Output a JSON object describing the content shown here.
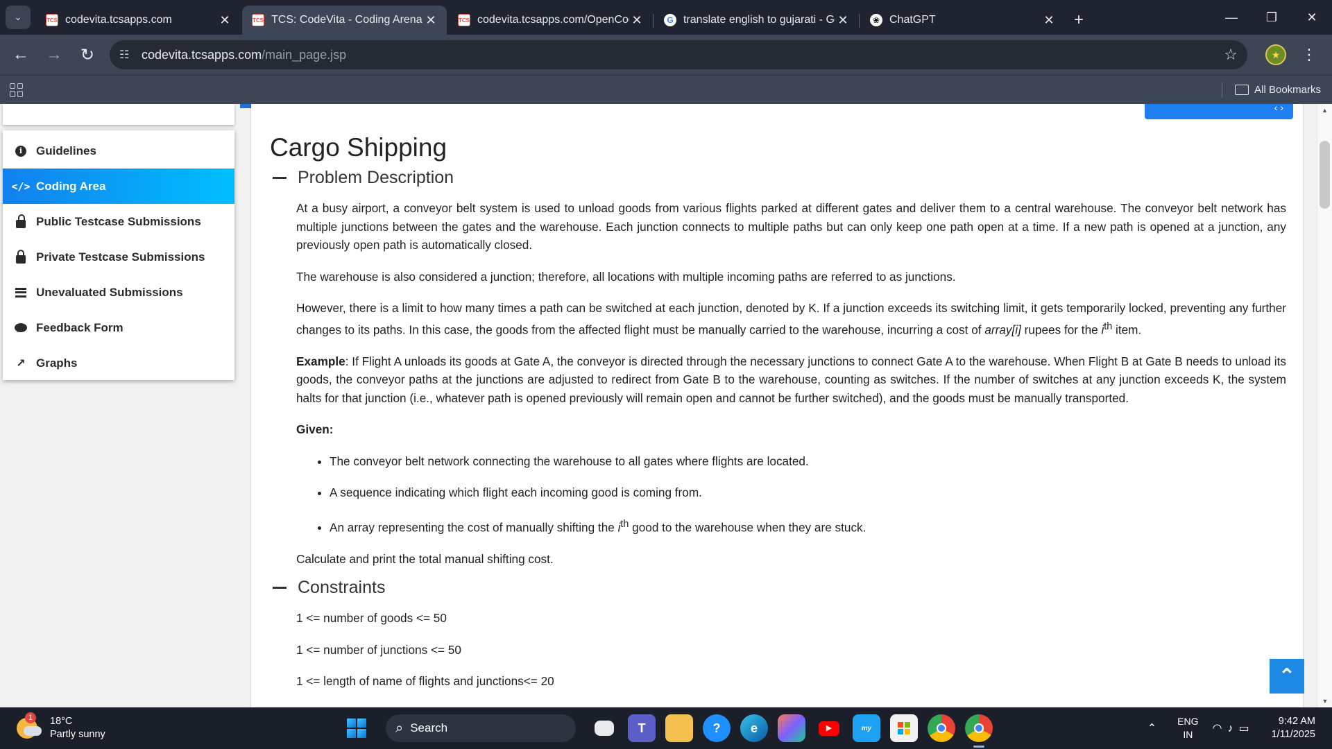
{
  "browser": {
    "tabs": [
      {
        "title": "codevita.tcsapps.com",
        "favicon": "tcs-icon",
        "active": false
      },
      {
        "title": "TCS: CodeVita - Coding Arena",
        "favicon": "tcs-icon",
        "active": true
      },
      {
        "title": "codevita.tcsapps.com/OpenCod",
        "favicon": "tcs-icon",
        "active": false
      },
      {
        "title": "translate english to gujarati - Go",
        "favicon": "google-icon",
        "active": false
      },
      {
        "title": "ChatGPT",
        "favicon": "chatgpt-icon",
        "active": false
      }
    ],
    "url_host": "codevita.tcsapps.com",
    "url_path": "/main_page.jsp",
    "bookmarks_label": "All Bookmarks"
  },
  "sidebar": {
    "items": [
      {
        "label": "Guidelines",
        "icon": "info-icon",
        "active": false
      },
      {
        "label": "Coding Area",
        "icon": "code-icon",
        "active": true
      },
      {
        "label": "Public Testcase Submissions",
        "icon": "unlock-icon",
        "active": false
      },
      {
        "label": "Private Testcase Submissions",
        "icon": "lock-icon",
        "active": false
      },
      {
        "label": "Unevaluated Submissions",
        "icon": "list-icon",
        "active": false
      },
      {
        "label": "Feedback Form",
        "icon": "comment-icon",
        "active": false
      },
      {
        "label": "Graphs",
        "icon": "chart-icon",
        "active": false
      }
    ]
  },
  "problem": {
    "title": "Cargo Shipping",
    "description_heading": "Problem Description",
    "p1": "At a busy airport, a conveyor belt system is used to unload goods from various flights parked at different gates and deliver them to a central warehouse. The conveyor belt network has multiple junctions between the gates and the warehouse. Each junction connects to multiple paths but can only keep one path open at a time. If a new path is opened at a junction, any previously open path is automatically closed.",
    "p2": "The warehouse is also considered a junction; therefore, all locations with multiple incoming paths are referred to as junctions.",
    "p3_a": "However, there is a limit to how many times a path can be switched at each junction, denoted by K. If a junction exceeds its switching limit, it gets temporarily locked, preventing any further changes to its paths. In this case, the goods from the affected flight must be manually carried to the warehouse, incurring a cost of ",
    "p3_em": "array[i]",
    "p3_b": " rupees for the ",
    "p3_i": "i",
    "p3_sup": "th",
    "p3_c": " item.",
    "example_label": "Example",
    "example_text": ": If Flight A unloads its goods at Gate A, the conveyor is directed through the necessary junctions to connect Gate A to the warehouse. When Flight B at Gate B needs to unload its goods, the conveyor paths at the junctions are adjusted to redirect from Gate B to the warehouse, counting as switches. If the number of switches at any junction exceeds K, the system halts for that junction (i.e., whatever path is opened previously will remain open and cannot be further switched), and the goods must be manually transported.",
    "given_label": "Given:",
    "given_1": "The conveyor belt network connecting the warehouse to all gates where flights are located.",
    "given_2": "A sequence indicating which flight each incoming good is coming from.",
    "given_3_a": "An array representing the cost of manually shifting the ",
    "given_3_i": "i",
    "given_3_sup": "th",
    "given_3_b": " good to the warehouse when they are stuck.",
    "calc": "Calculate and print the total manual shifting cost.",
    "constraints_heading": "Constraints",
    "constraints": [
      "1 <= number of goods <= 50",
      "1 <= number of junctions <= 50",
      "1 <= length of name of flights and junctions<= 20"
    ]
  },
  "taskbar": {
    "notification_count": "1",
    "weather_temp": "18°C",
    "weather_desc": "Partly sunny",
    "search_label": "Search",
    "lang_1": "ENG",
    "lang_2": "IN",
    "time": "9:42 AM",
    "date": "1/11/2025"
  },
  "colors": {
    "active_gradient_start": "#1180ee",
    "active_gradient_end": "#00bfff",
    "scroll_top_button": "#1e88e5"
  }
}
